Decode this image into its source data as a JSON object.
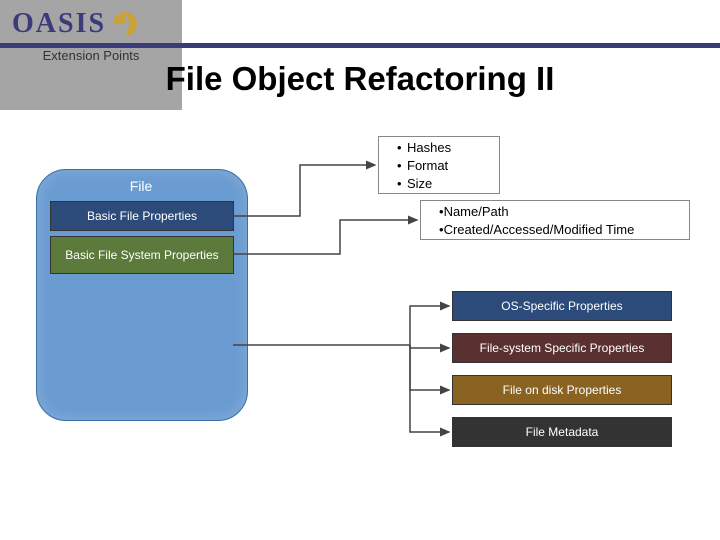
{
  "logo_text": "OASIS",
  "title": "File Object Refactoring II",
  "file_group": {
    "title": "File",
    "basic_props": "Basic File Properties",
    "basic_fs_props": "Basic File System Properties",
    "ext_points": "Extension Points"
  },
  "callout_bfp": {
    "i1": "Hashes",
    "i2": "Format",
    "i3": "Size"
  },
  "callout_bfsp": {
    "i1": "Name/Path",
    "i2": "Created/Accessed/Modified Time"
  },
  "ext_targets": {
    "os": "OS-Specific Properties",
    "fs": "File-system Specific Properties",
    "disk": "File on disk Properties",
    "meta": "File Metadata"
  }
}
